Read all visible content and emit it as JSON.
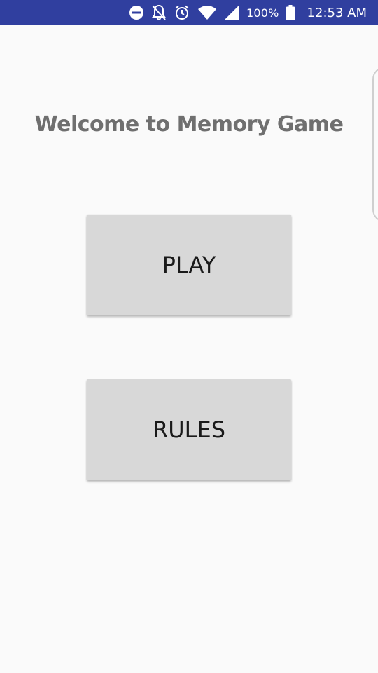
{
  "status_bar": {
    "background_color": "#303f9f",
    "icons": [
      "do-not-disturb-icon",
      "notifications-off-icon",
      "alarm-icon",
      "wifi-icon",
      "signal-icon",
      "battery-icon"
    ],
    "battery_percent": "100%",
    "time": "12:53 AM"
  },
  "main": {
    "title": "Welcome to Memory Game",
    "buttons": {
      "play_label": "PLAY",
      "rules_label": "RULES"
    },
    "colors": {
      "background": "#fafafa",
      "title_text": "#6f6f6f",
      "button_bg": "#d8d8d8",
      "button_text": "#1a1a1a"
    }
  }
}
